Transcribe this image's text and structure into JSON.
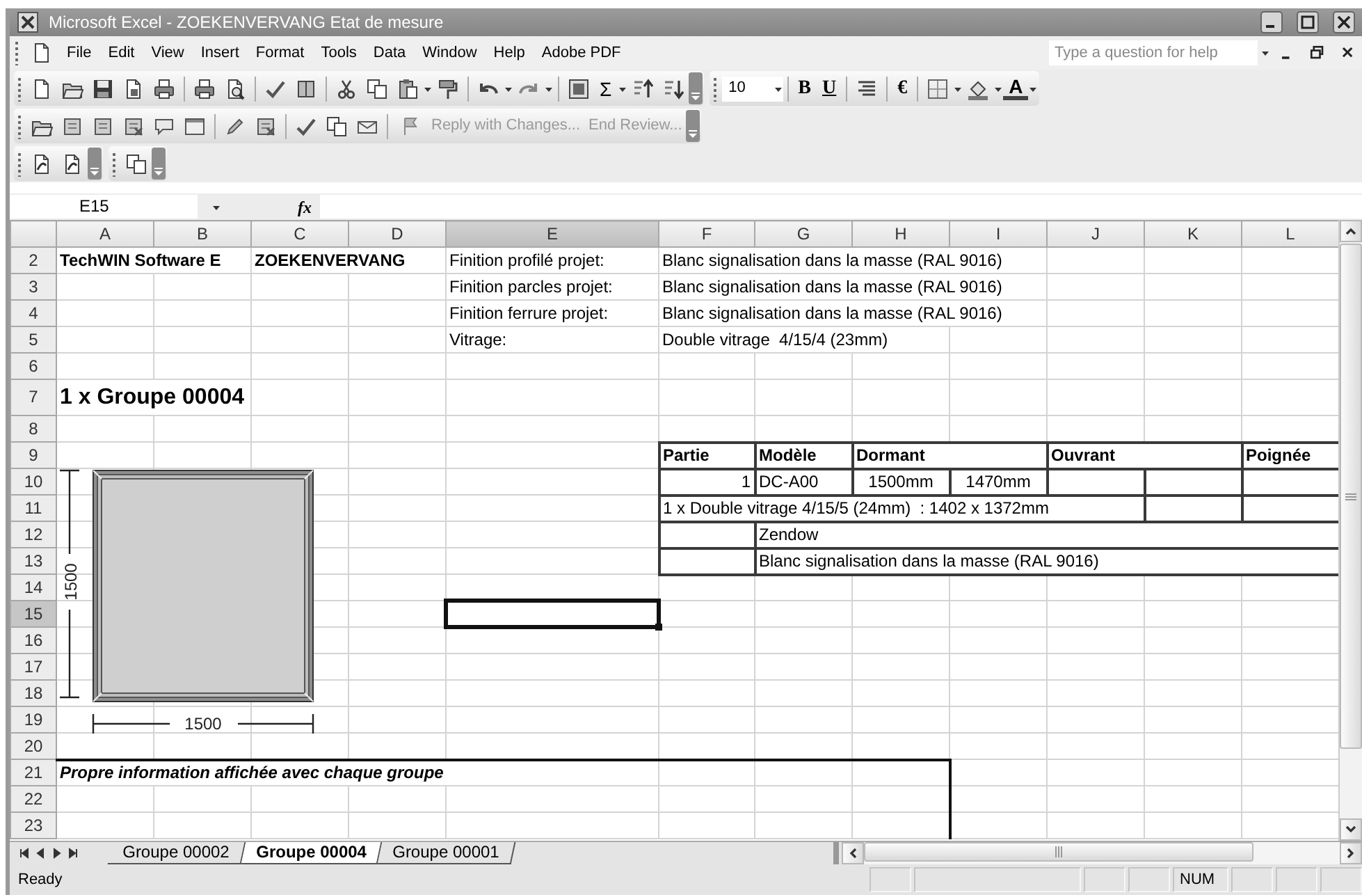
{
  "window": {
    "title": "Microsoft Excel - ZOEKENVERVANG Etat de mesure"
  },
  "menu": [
    "File",
    "Edit",
    "View",
    "Insert",
    "Format",
    "Tools",
    "Data",
    "Window",
    "Help",
    "Adobe PDF"
  ],
  "help_box": {
    "placeholder": "Type a question for help"
  },
  "toolbar": {
    "sum_button": "Σ",
    "font_size": "10",
    "bold_button": "B",
    "underline_button": "U",
    "euro_button": "€",
    "font_color_button": "A"
  },
  "review_toolbar": {
    "reply_button": {
      "label": "Reply with Changes...",
      "disabled": true
    },
    "end_review_button": {
      "label": "End Review...",
      "disabled": true
    }
  },
  "formula_bar": {
    "name_box": "E15",
    "function_label": "fx"
  },
  "sheet": {
    "columns": [
      {
        "label": "A",
        "selected": false
      },
      {
        "label": "B",
        "selected": false
      },
      {
        "label": "C",
        "selected": false
      },
      {
        "label": "D",
        "selected": false
      },
      {
        "label": "E",
        "selected": true
      },
      {
        "label": "F",
        "selected": false
      },
      {
        "label": "G",
        "selected": false
      },
      {
        "label": "H",
        "selected": false
      },
      {
        "label": "I",
        "selected": false
      },
      {
        "label": "J",
        "selected": false
      },
      {
        "label": "K",
        "selected": false
      },
      {
        "label": "L",
        "selected": false
      }
    ],
    "rows": [
      {
        "label": "2",
        "selected": false,
        "cells": [
          {
            "text": "TechWIN Software E",
            "bold": true
          },
          {},
          {
            "text": "ZOEKENVERVANG",
            "bold": true
          },
          {},
          {
            "text": "Finition profilé projet:"
          },
          {
            "text": "Blanc signalisation dans la masse (RAL 9016)"
          },
          {},
          {},
          {},
          {},
          {},
          {}
        ]
      },
      {
        "label": "3",
        "selected": false,
        "cells": [
          {},
          {},
          {},
          {},
          {
            "text": "Finition parcles projet:"
          },
          {
            "text": "Blanc signalisation dans la masse (RAL 9016)"
          },
          {},
          {},
          {},
          {},
          {},
          {}
        ]
      },
      {
        "label": "4",
        "selected": false,
        "cells": [
          {},
          {},
          {},
          {},
          {
            "text": "Finition ferrure projet:"
          },
          {
            "text": "Blanc signalisation dans la masse (RAL 9016)"
          },
          {},
          {},
          {},
          {},
          {},
          {}
        ]
      },
      {
        "label": "5",
        "selected": false,
        "cells": [
          {},
          {},
          {},
          {},
          {
            "text": "Vitrage:"
          },
          {
            "text": "Double vitrage  4/15/4 (23mm)"
          },
          {},
          {},
          {},
          {},
          {},
          {}
        ]
      },
      {
        "label": "6",
        "selected": false
      },
      {
        "label": "7",
        "selected": false,
        "cells": [
          {
            "text": "1 x Groupe 00004",
            "bold": true,
            "large": true
          },
          {},
          {},
          {},
          {},
          {},
          {},
          {},
          {},
          {},
          {},
          {}
        ]
      },
      {
        "label": "8",
        "selected": false
      },
      {
        "label": "9",
        "selected": false,
        "cells": [
          {},
          {},
          {},
          {},
          {},
          {
            "text": "Partie",
            "bold": true,
            "boxed": true
          },
          {
            "text": "Modèle",
            "bold": true,
            "boxed": true
          },
          {
            "text": "Dormant",
            "bold": true,
            "boxed": true
          },
          {},
          {
            "text": "Ouvrant",
            "bold": true,
            "boxed": true
          },
          {},
          {
            "text": "Poignée",
            "bold": true,
            "boxed": true
          }
        ]
      },
      {
        "label": "10",
        "selected": false,
        "cells": [
          {},
          {},
          {},
          {},
          {},
          {
            "text": "1",
            "right_aligned": true,
            "boxed": true
          },
          {
            "text": "DC-A00",
            "boxed": true
          },
          {
            "text": "1500mm",
            "centered": true,
            "boxed": true
          },
          {
            "text": "1470mm",
            "centered": true,
            "boxed": true
          },
          {
            "boxed": true
          },
          {
            "boxed": true
          },
          {
            "boxed": true
          }
        ]
      },
      {
        "label": "11",
        "selected": false,
        "cells": [
          {},
          {},
          {},
          {},
          {},
          {
            "text": "1 x Double vitrage 4/15/5 (24mm)  : 1402 x 1372mm",
            "boxed": true
          },
          {},
          {},
          {},
          {},
          {
            "boxed": true
          },
          {
            "boxed": true
          }
        ]
      },
      {
        "label": "12",
        "selected": false,
        "cells": [
          {},
          {},
          {},
          {},
          {},
          {
            "boxed": true
          },
          {
            "text": "Zendow",
            "boxed": true
          },
          {},
          {},
          {},
          {},
          {}
        ]
      },
      {
        "label": "13",
        "selected": false,
        "cells": [
          {},
          {},
          {},
          {},
          {},
          {
            "boxed": true
          },
          {
            "text": "Blanc signalisation dans la masse (RAL 9016)",
            "boxed": true
          },
          {},
          {},
          {},
          {},
          {}
        ]
      },
      {
        "label": "14",
        "selected": false
      },
      {
        "label": "15",
        "selected": true,
        "cells": [
          {},
          {},
          {},
          {},
          {
            "selected": true
          },
          {},
          {},
          {},
          {},
          {},
          {},
          {}
        ]
      },
      {
        "label": "16",
        "selected": false
      },
      {
        "label": "17",
        "selected": false
      },
      {
        "label": "18",
        "selected": false
      },
      {
        "label": "19",
        "selected": false
      },
      {
        "label": "20",
        "selected": false
      },
      {
        "label": "21",
        "selected": false,
        "cells": [
          {
            "text": "Propre information affichée avec chaque groupe",
            "bold": true,
            "italic": true,
            "frame_top": true
          },
          {},
          {},
          {},
          {},
          {
            "frame_top": true
          },
          {
            "frame_top": true
          },
          {
            "frame_top": true,
            "frame_right": true
          },
          {},
          {},
          {},
          {}
        ]
      },
      {
        "label": "22",
        "selected": false,
        "cells": [
          {},
          {},
          {},
          {},
          {},
          {},
          {},
          {
            "frame_right": true
          },
          {},
          {},
          {},
          {}
        ]
      },
      {
        "label": "23",
        "selected": false,
        "cells": [
          {},
          {},
          {},
          {},
          {},
          {},
          {},
          {
            "frame_right": true
          },
          {},
          {},
          {},
          {}
        ]
      }
    ]
  },
  "drawing": {
    "width_label": "1500",
    "height_label": "1500"
  },
  "sheet_tabs": [
    {
      "label": "Groupe 00002",
      "selected": false
    },
    {
      "label": "Groupe 00004",
      "selected": true
    },
    {
      "label": "Groupe 00001",
      "selected": false
    }
  ],
  "status_bar": {
    "text": "Ready",
    "indicators": [
      "NUM"
    ]
  }
}
